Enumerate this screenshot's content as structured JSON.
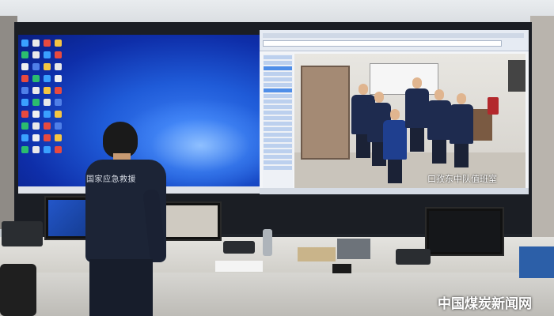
{
  "scene": {
    "operator_back_text": "国家应急救援",
    "video_caption": "口孜东中队值班室",
    "watermark": "中国煤炭新闻网"
  },
  "colors": {
    "desktop_blue": "#1f5bd8",
    "uniform_navy": "#1c2436",
    "chair_red": "#b3282c"
  }
}
